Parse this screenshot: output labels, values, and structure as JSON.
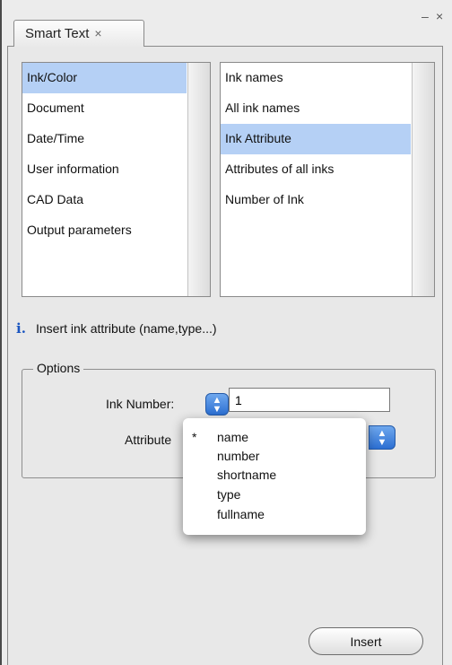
{
  "window": {
    "tab_title": "Smart Text",
    "tab_close": "×",
    "minimize": "–",
    "close": "×"
  },
  "categories": {
    "selected": "Ink/Color",
    "items": [
      "Ink/Color",
      "Document",
      "Date/Time",
      "User information",
      "CAD Data",
      "Output parameters"
    ]
  },
  "fields": {
    "selected": "Ink Attribute",
    "items": [
      "Ink names",
      "All ink names",
      "Ink Attribute",
      "Attributes of all inks",
      "Number of Ink"
    ]
  },
  "hint": {
    "icon": "info-icon",
    "text": "Insert ink attribute (name,type...)"
  },
  "options": {
    "legend": "Options",
    "ink_number_label": "Ink Number:",
    "ink_number_value": "1",
    "attribute_label": "Attribute",
    "attribute_options": [
      "name",
      "number",
      "shortname",
      "type",
      "fullname"
    ],
    "attribute_selected": "name",
    "check_mark": "*"
  },
  "actions": {
    "insert_label": "Insert"
  },
  "colors": {
    "selection": "#b5d0f5",
    "accent": "#2c6fd2"
  }
}
